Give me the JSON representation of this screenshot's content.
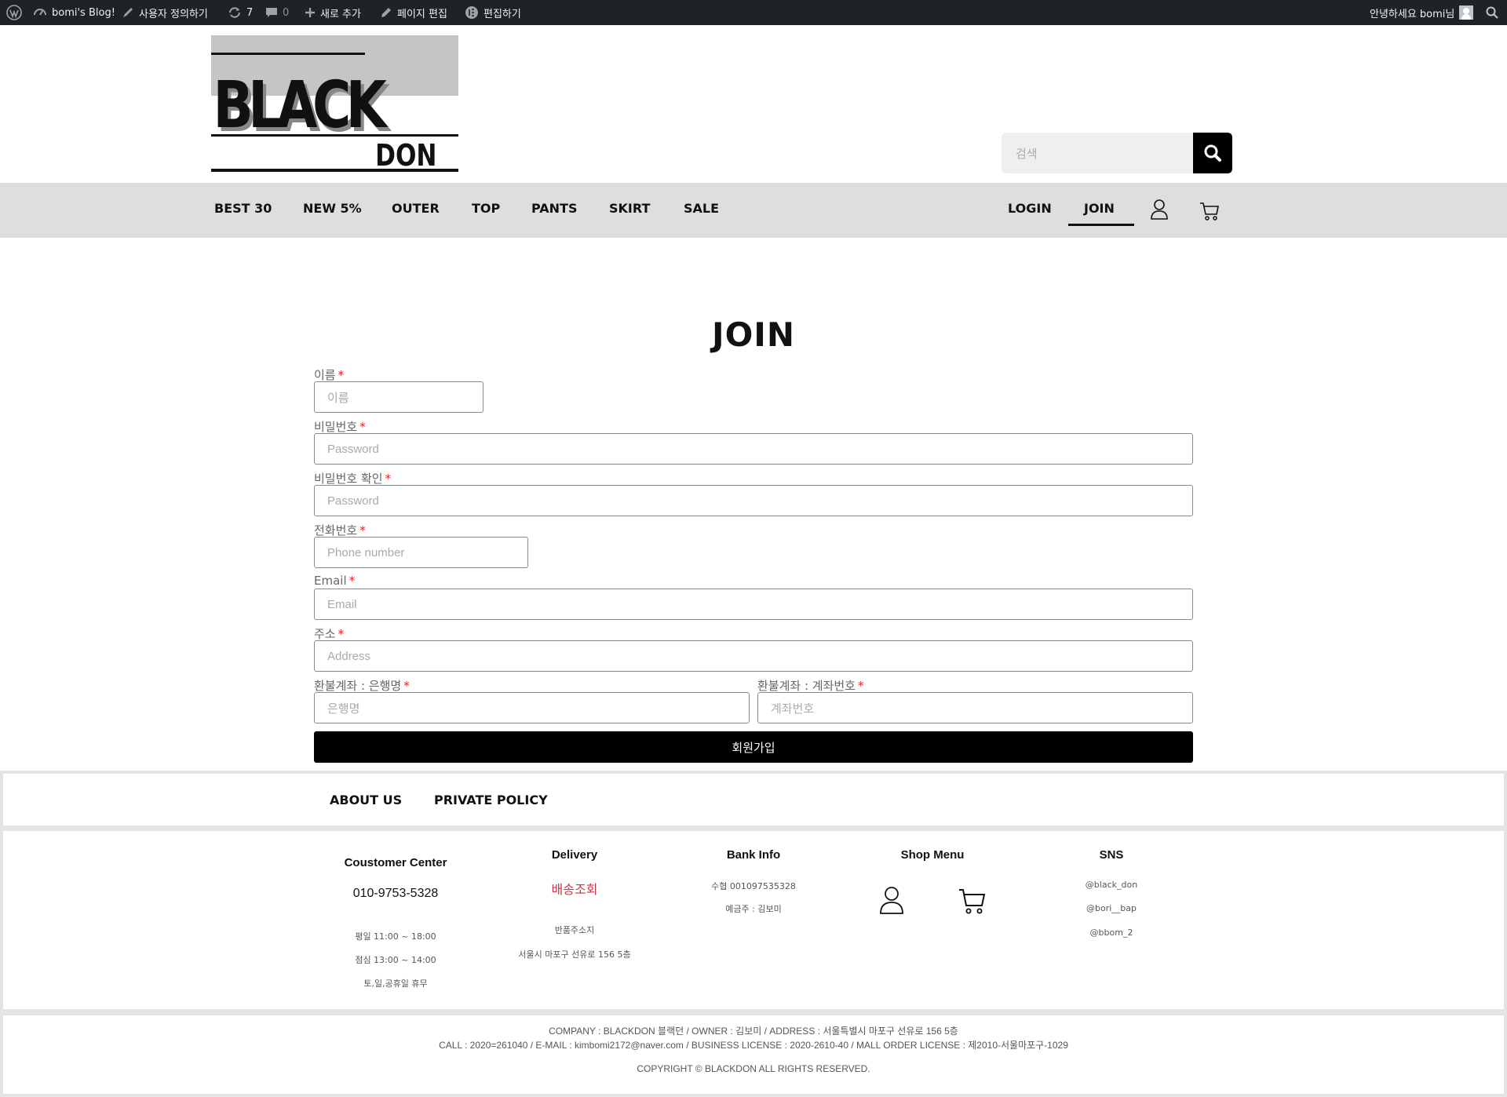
{
  "admin_bar": {
    "site_name": "bomi's Blog!",
    "customize": "사용자 정의하기",
    "updates_count": "7",
    "comments_count": "0",
    "new": "새로 추가",
    "edit_page": "페이지 편집",
    "edit_with_elementor": "편집하기",
    "greeting": "안녕하세요 bomi님"
  },
  "header": {
    "logo_main": "BLACK",
    "logo_sub": "DON",
    "search_placeholder": "검색"
  },
  "nav": {
    "items": [
      "BEST 30",
      "NEW 5%",
      "OUTER",
      "TOP",
      "PANTS",
      "SKIRT",
      "SALE"
    ],
    "login": "LOGIN",
    "join": "JOIN",
    "active": "JOIN"
  },
  "form": {
    "title": "JOIN",
    "required_mark": "*",
    "fields": [
      {
        "label": "이름",
        "placeholder": "이름"
      },
      {
        "label": "비밀번호",
        "placeholder": "Password"
      },
      {
        "label": "비밀번호 확인",
        "placeholder": "Password"
      },
      {
        "label": "전화번호",
        "placeholder": "Phone number"
      },
      {
        "label": "Email",
        "placeholder": "Email"
      },
      {
        "label": "주소",
        "placeholder": "Address"
      },
      {
        "label": "환불계좌 : 은행명",
        "placeholder": "은행명"
      },
      {
        "label": "환불계좌 : 계좌번호",
        "placeholder": "계좌번호"
      }
    ],
    "submit": "회원가입"
  },
  "footer": {
    "links": [
      "ABOUT US",
      "PRIVATE POLICY"
    ],
    "customer_center": {
      "title": "Coustomer Center",
      "phone": "010-9753-5328",
      "lines": [
        "평일 11:00 ~ 18:00",
        "점심 13:00 ~ 14:00",
        "토,일,공휴일 휴무"
      ]
    },
    "delivery": {
      "title": "Delivery",
      "tracking": "배송조회",
      "lines": [
        "반품주소지",
        "서울시 마포구 선유로 156 5층"
      ]
    },
    "bank": {
      "title": "Bank Info",
      "lines": [
        "수협  001097535328",
        "예금주 : 김보미"
      ]
    },
    "shop_menu": {
      "title": "Shop Menu"
    },
    "sns": {
      "title": "SNS",
      "lines": [
        "@black_don",
        "@bori__bap",
        "@bbom_2"
      ]
    },
    "company_line1": "COMPANY : BLACKDON 블랙던 / OWNER : 김보미 / ADDRESS :  서울특별시 마포구 선유로 156 5층",
    "company_line2": "CALL : 2020=261040 / E-MAIL : kimbomi2172@naver.com / BUSINESS LICENSE : 2020-2610-40 / MALL ORDER LICENSE : 제2010-서울마포구-1029",
    "copyright": "COPYRIGHT © BLACKDON ALL RIGHTS RESERVED."
  },
  "colors": {
    "admin_bar": "#1d2327",
    "nav_bg": "#dedede",
    "accent_red": "#c8374a",
    "required": "#e02020"
  }
}
